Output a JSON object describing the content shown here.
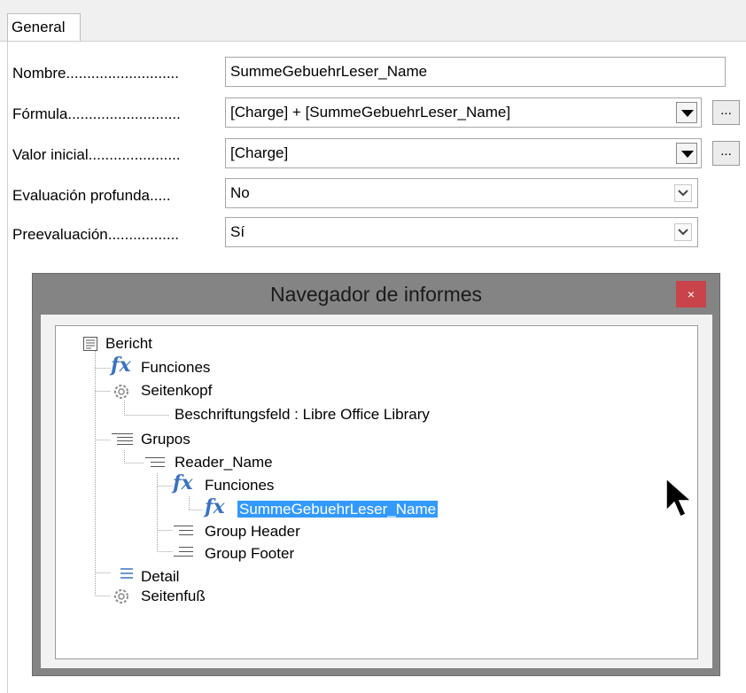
{
  "tabs": [
    {
      "label": "General"
    }
  ],
  "properties": {
    "nombre": {
      "label": "Nombre...........................",
      "value": "SummeGebuehrLeser_Name"
    },
    "formula": {
      "label": "Fórmula...........................",
      "value": "[Charge] + [SummeGebuehrLeser_Name]",
      "button": "..."
    },
    "valor_inicial": {
      "label": "Valor inicial......................",
      "value": "[Charge]",
      "button": "..."
    },
    "evaluacion": {
      "label": "Evaluación profunda.....",
      "value": "No"
    },
    "preevaluacion": {
      "label": "Preevaluación.................",
      "value": "Sí"
    }
  },
  "navigator": {
    "title": "Navegador de informes",
    "close": "×",
    "tree": {
      "bericht": "Bericht",
      "funciones": "Funciones",
      "seitenkopf": "Seitenkopf",
      "beschriftungsfeld": "Beschriftungsfeld : Libre Office Library",
      "grupos": "Grupos",
      "reader_name": "Reader_Name",
      "funciones_sub": "Funciones",
      "summe": "SummeGebuehrLeser_Name",
      "group_header": "Group Header",
      "group_footer": "Group Footer",
      "detail": "Detail",
      "seitenfuss": "Seitenfuß"
    },
    "fx_glyph": "fx"
  },
  "colors": {
    "accent": "#3399ff",
    "fx_blue": "#3b72c4",
    "close_red": "#c9434a"
  }
}
